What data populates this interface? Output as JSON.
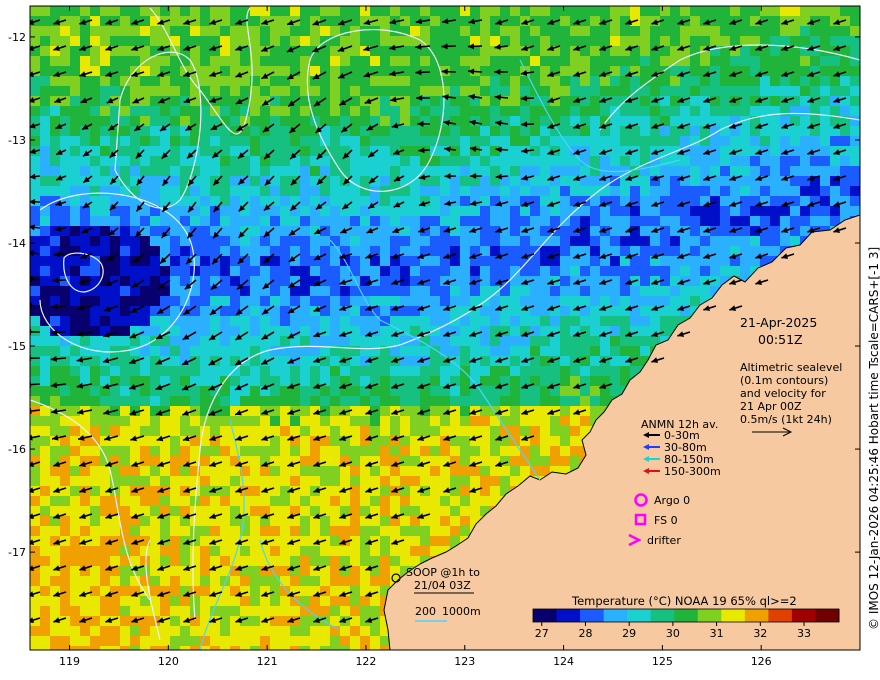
{
  "map": {
    "lon_range": [
      118.6,
      127.0
    ],
    "lat_range": [
      -17.95,
      -11.7
    ],
    "lon_ticks": [
      "119",
      "120",
      "121",
      "122",
      "123",
      "124",
      "125",
      "126"
    ],
    "lat_ticks": [
      "-12",
      "-13",
      "-14",
      "-15",
      "-16",
      "-17"
    ],
    "land_color": "#f6c9a0"
  },
  "info": {
    "date": "21-Apr-2025",
    "time": "00:51Z",
    "alt_line1": "Altimetric sealevel",
    "alt_line2": "(0.1m contours)",
    "alt_line3": "and velocity for",
    "alt_line4": "21 Apr 00Z",
    "alt_line5": "0.5m/s (1kt 24h)"
  },
  "anmn": {
    "title": "ANMN 12h av.",
    "items": [
      {
        "label": "0-30m",
        "color": "#000000"
      },
      {
        "label": "30-80m",
        "color": "#1f3cff"
      },
      {
        "label": "80-150m",
        "color": "#18d4d4"
      },
      {
        "label": "150-300m",
        "color": "#e01010"
      }
    ]
  },
  "markers": {
    "argo": "Argo 0",
    "fs": "FS 0",
    "drifter": "drifter",
    "marker_color": "#ff00ff"
  },
  "soop": {
    "line1": "SOOP @1h to",
    "line2": "21/04 03Z"
  },
  "depth": {
    "label_200": "200",
    "label_1000": "1000m"
  },
  "colorbar": {
    "title": "Temperature (°C) NOAA 19 65% ql>=2",
    "ticks": [
      "27",
      "28",
      "29",
      "30",
      "31",
      "32",
      "33"
    ],
    "range": [
      26.8,
      33.8
    ],
    "colors": [
      "#08006e",
      "#0010c8",
      "#1a5cff",
      "#2ab0ff",
      "#1ad0d0",
      "#15c080",
      "#20b43a",
      "#7fd020",
      "#e8e800",
      "#f0a000",
      "#e04000",
      "#a00000",
      "#700000"
    ]
  },
  "credit": "© IMOS 12-Jan-2026 04:25:46 Hobart time Tscale=CARS+[-1 3]"
}
